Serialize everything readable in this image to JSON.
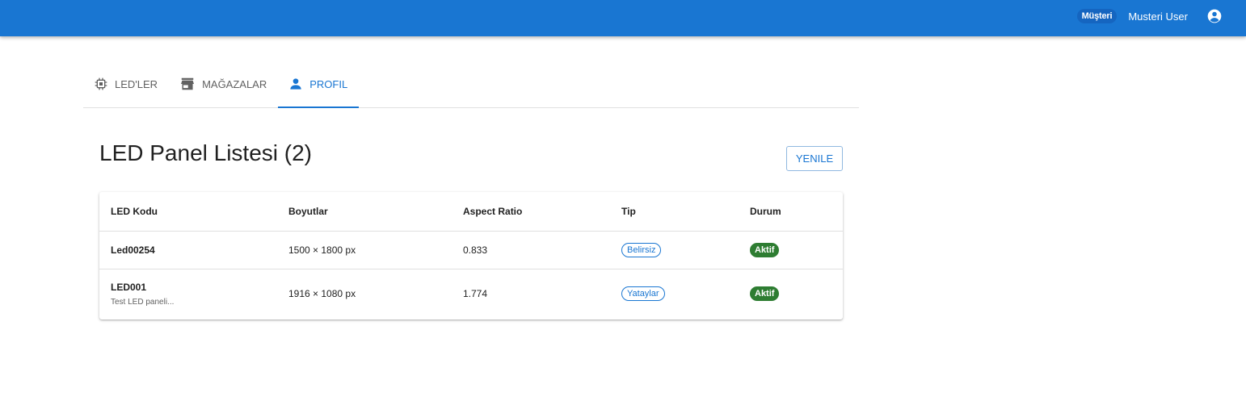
{
  "header": {
    "role_badge": "Müşteri",
    "user_name": "Musteri User",
    "account_icon": "account-circle-icon"
  },
  "tabs": [
    {
      "label": "LED'LER",
      "icon": "chip-icon"
    },
    {
      "label": "MAĞAZALAR",
      "icon": "store-icon"
    },
    {
      "label": "PROFIL",
      "icon": "person-icon"
    }
  ],
  "active_tab": "PROFIL",
  "page": {
    "title": "LED Panel Listesi (2)",
    "refresh_label": "YENILE"
  },
  "table": {
    "columns": [
      "LED Kodu",
      "Boyutlar",
      "Aspect Ratio",
      "Tip",
      "Durum"
    ],
    "rows": [
      {
        "code": "Led00254",
        "description": "",
        "dimensions": "1500 × 1800 px",
        "aspect_ratio": "0.833",
        "type": "Belirsiz",
        "status": "Aktif"
      },
      {
        "code": "LED001",
        "description": "Test LED paneli...",
        "dimensions": "1916 × 1080 px",
        "aspect_ratio": "1.774",
        "type": "Yataylar",
        "status": "Aktif"
      }
    ]
  },
  "colors": {
    "primary": "#1976d2",
    "status_active": "#2e7d32"
  }
}
